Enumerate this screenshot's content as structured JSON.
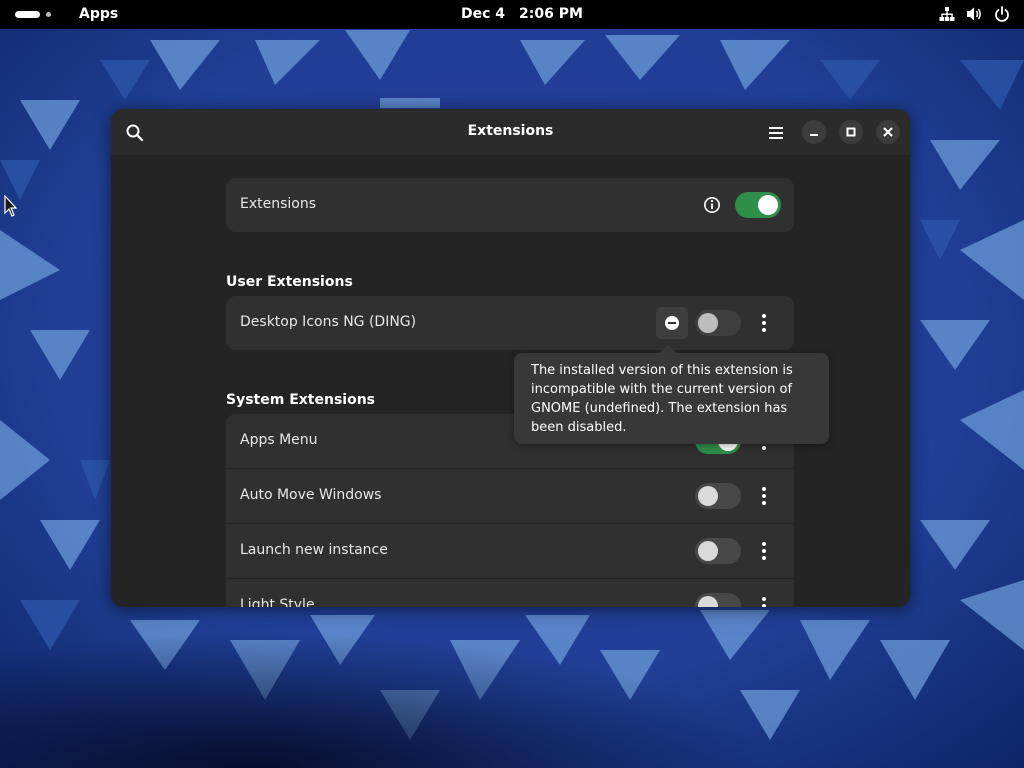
{
  "topbar": {
    "apps_label": "Apps",
    "date": "Dec 4",
    "time": "2:06 PM",
    "tray_icons": [
      "network-icon",
      "volume-icon",
      "power-icon"
    ]
  },
  "window": {
    "title": "Extensions",
    "main_toggle": {
      "label": "Extensions",
      "enabled": true
    },
    "user_extensions": {
      "title": "User Extensions",
      "items": [
        {
          "name": "Desktop Icons NG (DING)",
          "enabled": false,
          "error": true
        }
      ]
    },
    "tooltip": "The installed version of this extension is incompatible with the current version of GNOME (undefined). The extension has been disabled.",
    "system_extensions": {
      "title": "System Extensions",
      "items": [
        {
          "name": "Apps Menu",
          "enabled": true
        },
        {
          "name": "Auto Move Windows",
          "enabled": false
        },
        {
          "name": "Launch new instance",
          "enabled": false
        },
        {
          "name": "Light Style",
          "enabled": false
        }
      ]
    }
  },
  "colors": {
    "toggle_on": "#2f8f4a",
    "window_bg": "#242424",
    "card_bg": "#303030",
    "tooltip_bg": "#383838"
  }
}
